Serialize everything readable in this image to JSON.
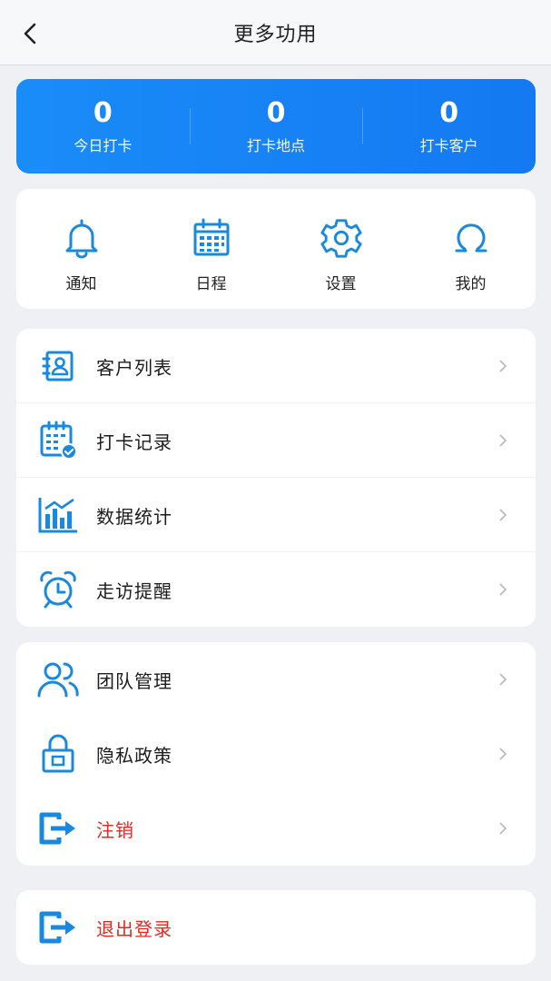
{
  "header": {
    "title": "更多功用",
    "back_icon": "chevron-left-icon"
  },
  "stats": [
    {
      "value": "0",
      "label": "今日打卡"
    },
    {
      "value": "0",
      "label": "打卡地点"
    },
    {
      "value": "0",
      "label": "打卡客户"
    }
  ],
  "quick_actions": [
    {
      "label": "通知",
      "icon": "bell-icon"
    },
    {
      "label": "日程",
      "icon": "calendar-icon"
    },
    {
      "label": "设置",
      "icon": "gear-icon"
    },
    {
      "label": "我的",
      "icon": "user-icon"
    }
  ],
  "menu_a": [
    {
      "label": "客户列表",
      "icon": "contact-book-icon"
    },
    {
      "label": "打卡记录",
      "icon": "checkin-record-icon"
    },
    {
      "label": "数据统计",
      "icon": "bar-chart-icon"
    },
    {
      "label": "走访提醒",
      "icon": "alarm-clock-icon"
    }
  ],
  "menu_b": [
    {
      "label": "团队管理",
      "icon": "team-icon"
    },
    {
      "label": "隐私政策",
      "icon": "lock-icon"
    },
    {
      "label": "注销",
      "icon": "exit-icon"
    }
  ],
  "logout": {
    "label": "退出登录",
    "icon": "exit-icon"
  },
  "colors": {
    "accent": "#1479f2",
    "icon_blue": "#1989e0",
    "danger": "#e8261f",
    "background": "#eef0f4"
  }
}
